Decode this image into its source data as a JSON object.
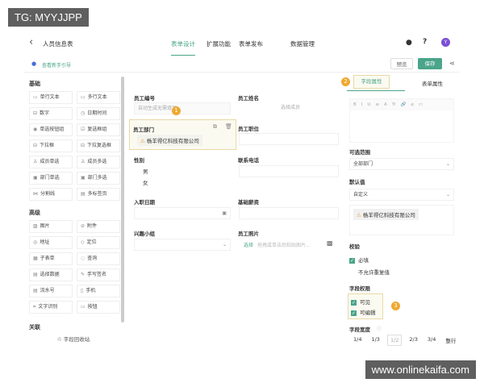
{
  "watermarks": {
    "top": "TG: MYYJJPP",
    "bottom": "www.onlinekaifa.com"
  },
  "header": {
    "back_icon": "chevron-left-icon",
    "title": "人员信息表",
    "tabs": [
      "表单设计",
      "扩展功能",
      "表单发布",
      "数据管理"
    ],
    "active_tab": 0,
    "avatar": "Y",
    "accent": "#4aa58a"
  },
  "subbar": {
    "guide": "查看新手引导",
    "preview": "预览",
    "save": "保存"
  },
  "palette": {
    "basic_title": "基础",
    "basic": [
      {
        "i": "▭",
        "t": "单行文本"
      },
      {
        "i": "▭",
        "t": "多行文本"
      },
      {
        "i": "⊟",
        "t": "数字"
      },
      {
        "i": "◷",
        "t": "日期时间"
      },
      {
        "i": "◉",
        "t": "单选按钮组"
      },
      {
        "i": "☑",
        "t": "复选框组"
      },
      {
        "i": "⊟",
        "t": "下拉框"
      },
      {
        "i": "⊟",
        "t": "下拉复选框"
      },
      {
        "i": "♙",
        "t": "成员单选"
      },
      {
        "i": "♙",
        "t": "成员多选"
      },
      {
        "i": "▣",
        "t": "部门单选"
      },
      {
        "i": "▣",
        "t": "部门多选"
      },
      {
        "i": "⋈",
        "t": "分割线"
      },
      {
        "i": "▤",
        "t": "多标签页"
      }
    ],
    "advanced_title": "高级",
    "advanced": [
      {
        "i": "▨",
        "t": "图片"
      },
      {
        "i": "⊘",
        "t": "附件"
      },
      {
        "i": "◎",
        "t": "地址"
      },
      {
        "i": "◇",
        "t": "定位"
      },
      {
        "i": "▦",
        "t": "子表单"
      },
      {
        "i": "◌",
        "t": "查询"
      },
      {
        "i": "▤",
        "t": "选择数据"
      },
      {
        "i": "✎",
        "t": "手写签名"
      },
      {
        "i": "▤",
        "t": "流水号"
      },
      {
        "i": "▯",
        "t": "手机"
      },
      {
        "i": "⌗",
        "t": "文字识别"
      },
      {
        "i": "▭",
        "t": "按钮"
      }
    ],
    "relation_title": "关联",
    "recycle": "字段回收站"
  },
  "form": {
    "emp_no": {
      "label": "员工编号",
      "placeholder": "自动生成无需填写"
    },
    "emp_name": {
      "label": "员工姓名",
      "placeholder": "选择成员"
    },
    "dept": {
      "label": "员工部门",
      "value": "杨羊得亿科技有限公司"
    },
    "position": {
      "label": "员工职位"
    },
    "gender": {
      "label": "性别",
      "options": [
        "男",
        "女"
      ]
    },
    "phone": {
      "label": "联系电话"
    },
    "hire_date": {
      "label": "入职日期"
    },
    "salary": {
      "label": "基础薪资"
    },
    "group": {
      "label": "兴趣小组"
    },
    "photo": {
      "label": "员工照片",
      "select": "选择",
      "hint": "拖拽或单击后粘贴图片..."
    },
    "badges": [
      "1",
      "2",
      "3"
    ]
  },
  "props": {
    "tabs": [
      "字段属性",
      "表单属性"
    ],
    "toolbar": [
      "B",
      "I",
      "U",
      "≡",
      "A",
      "Tr",
      "🔗",
      "⌀",
      "▭"
    ],
    "range_label": "可选范围",
    "range_value": "全部部门",
    "default_label": "默认值",
    "default_value": "自定义",
    "default_tag": "杨羊得亿科技有限公司",
    "validate_label": "校验",
    "required": "必填",
    "no_dup": "不允许重复值",
    "perm_label": "字段权限",
    "visible": "可见",
    "editable": "可编辑",
    "width_label": "字段宽度",
    "widths": [
      "1/4",
      "1/3",
      "1/2",
      "2/3",
      "3/4",
      "整行"
    ],
    "width_selected": "1/2"
  }
}
